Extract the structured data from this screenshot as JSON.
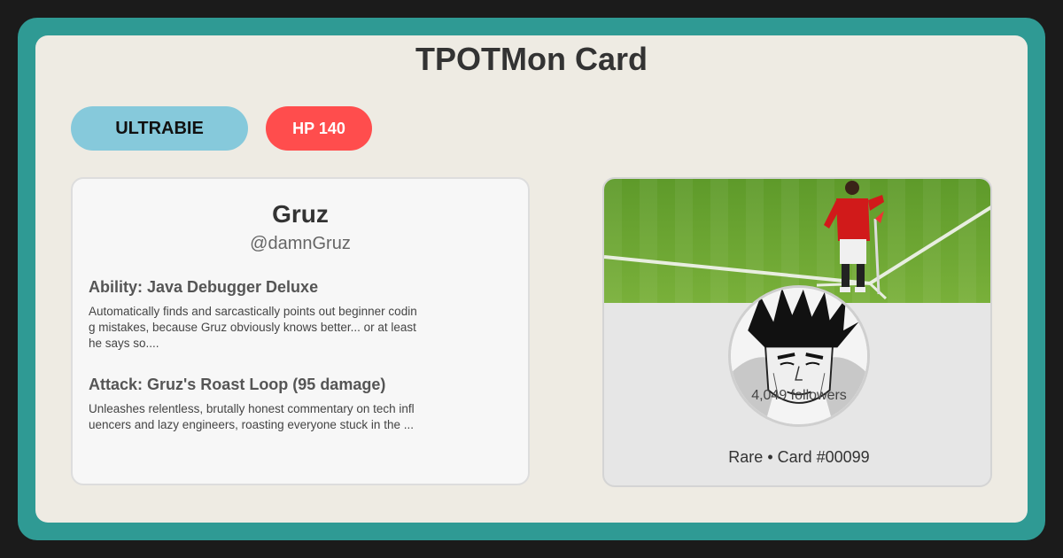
{
  "card": {
    "title": "TPOTMon Card",
    "type_label": "ULTRABIE",
    "hp_label": "HP 140"
  },
  "profile": {
    "name": "Gruz",
    "handle": "@damnGruz"
  },
  "ability": {
    "title": "Ability: Java Debugger Deluxe",
    "description": "Automatically finds and sarcastically points out beginner coding mistakes, because Gruz obviously knows better... or at least he says so...."
  },
  "attack": {
    "title": "Attack: Gruz's Roast Loop (95 damage)",
    "description": "Unleashes relentless, brutally honest commentary on tech influencers and lazy engineers, roasting everyone stuck in the ..."
  },
  "stats": {
    "followers": "4,049 followers"
  },
  "footer": {
    "rarity_line": "Rare • Card #00099"
  },
  "colors": {
    "frame": "#2f9a94",
    "card_bg": "#eeebe3",
    "type_pill": "#86c9db",
    "hp_pill": "#ff4d4d"
  }
}
